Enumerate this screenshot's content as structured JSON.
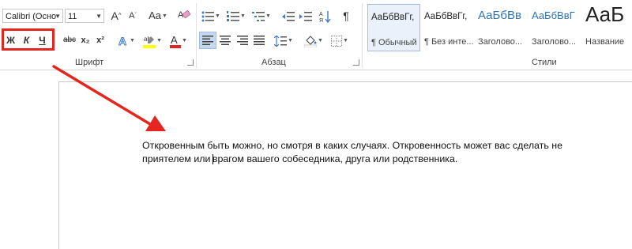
{
  "font": {
    "name_value": "Calibri (Осно",
    "size_value": "11",
    "bold_label": "Ж",
    "italic_label": "К",
    "underline_label": "Ч",
    "strike_label": "abc",
    "subscript_label": "x₂",
    "superscript_label": "x²",
    "grow_label": "A",
    "shrink_label": "A",
    "case_label": "Aa",
    "group_label": "Шрифт"
  },
  "paragraph": {
    "pilcrow_label": "¶",
    "group_label": "Абзац"
  },
  "styles": {
    "group_label": "Стили",
    "items": [
      {
        "preview": "АаБбВвГг,",
        "name": "¶ Обычный"
      },
      {
        "preview": "АаБбВвГг,",
        "name": "¶ Без инте..."
      },
      {
        "preview": "АаБбВв",
        "name": "Заголово..."
      },
      {
        "preview": "АаБбВвГ",
        "name": "Заголово..."
      },
      {
        "preview": "АаБ",
        "name": "Название"
      }
    ]
  },
  "document": {
    "line1": "Откровенным быть можно, но смотря в каких случаях. Откровенность может вас сделать не",
    "line2_before_cursor": "приятелем или ",
    "line2_after_cursor": "врагом вашего собеседника, друга или родственника."
  },
  "colors": {
    "annotation": "#e52620",
    "highlight": "#ffff00",
    "font_color": "#e52620",
    "heading_blue": "#2e74b5",
    "active_button": "#c5d9ee"
  }
}
